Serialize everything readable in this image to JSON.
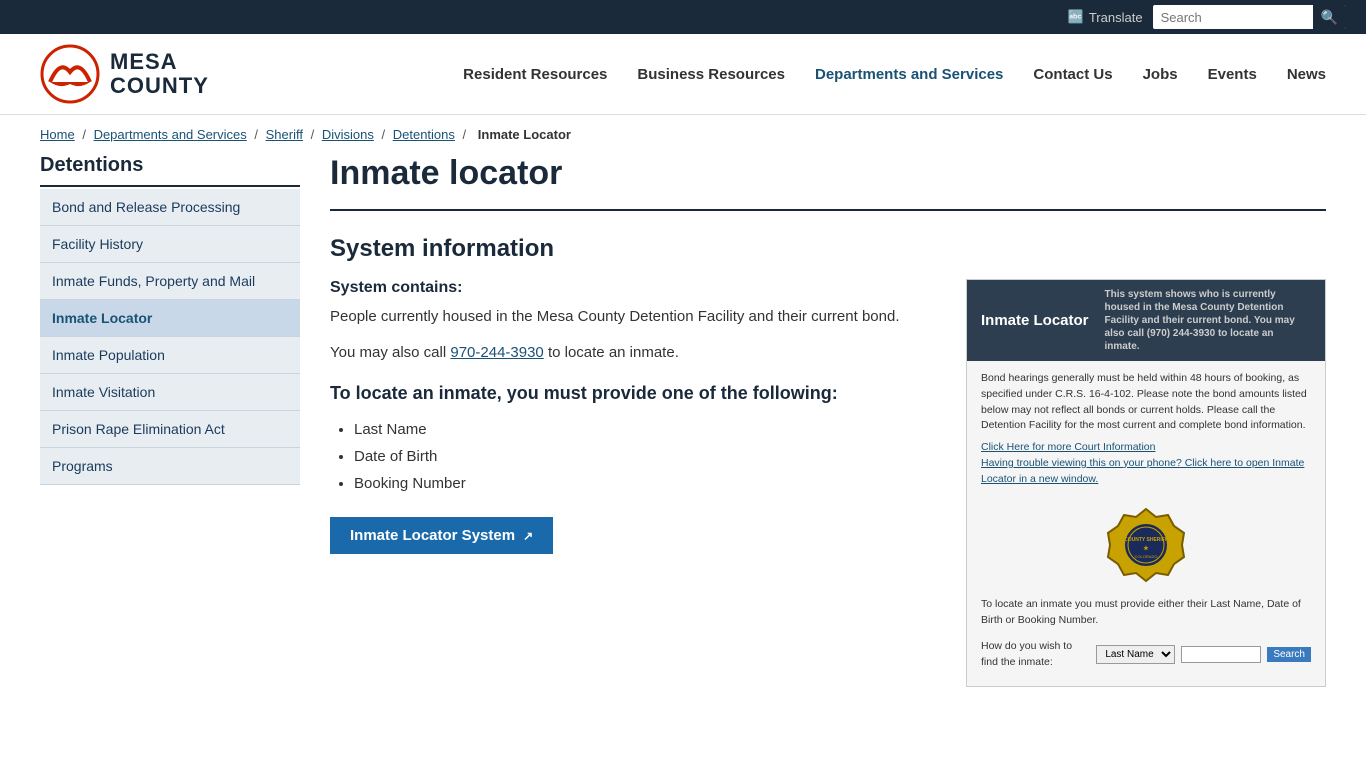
{
  "topbar": {
    "translate_label": "Translate",
    "search_placeholder": "Search"
  },
  "header": {
    "logo_text_line1": "MESA",
    "logo_text_line2": "COUNTY",
    "nav_items": [
      {
        "label": "Resident Resources",
        "id": "resident-resources"
      },
      {
        "label": "Business Resources",
        "id": "business-resources"
      },
      {
        "label": "Departments and Services",
        "id": "departments-services"
      },
      {
        "label": "Contact Us",
        "id": "contact-us"
      },
      {
        "label": "Jobs",
        "id": "jobs"
      },
      {
        "label": "Events",
        "id": "events"
      },
      {
        "label": "News",
        "id": "news"
      }
    ]
  },
  "breadcrumb": {
    "items": [
      {
        "label": "Home",
        "href": "#"
      },
      {
        "label": "Departments and Services",
        "href": "#"
      },
      {
        "label": "Sheriff",
        "href": "#"
      },
      {
        "label": "Divisions",
        "href": "#"
      },
      {
        "label": "Detentions",
        "href": "#"
      },
      {
        "label": "Inmate Locator",
        "current": true
      }
    ]
  },
  "sidebar": {
    "title": "Detentions",
    "items": [
      {
        "label": "Bond and Release Processing",
        "active": false
      },
      {
        "label": "Facility History",
        "active": false
      },
      {
        "label": "Inmate Funds, Property and Mail",
        "active": false
      },
      {
        "label": "Inmate Locator",
        "active": true
      },
      {
        "label": "Inmate Population",
        "active": false
      },
      {
        "label": "Inmate Visitation",
        "active": false
      },
      {
        "label": "Prison Rape Elimination Act",
        "active": false
      },
      {
        "label": "Programs",
        "active": false
      }
    ]
  },
  "main": {
    "page_title": "Inmate locator",
    "section_heading": "System information",
    "system_contains_label": "System contains:",
    "body_text_1": "People currently housed in the Mesa County Detention Facility and their current bond.",
    "body_text_2_prefix": "You may also call ",
    "phone": "970-244-3930",
    "body_text_2_suffix": " to locate an inmate.",
    "bold_heading": "To locate an inmate, you must provide one of the following:",
    "bullet_items": [
      "Last Name",
      "Date of Birth",
      "Booking Number"
    ],
    "cta_label": "Inmate Locator System"
  },
  "preview": {
    "header_title": "Inmate Locator",
    "header_desc": "This system shows who is currently housed in the Mesa County Detention Facility and their current bond. You may also call (970) 244-3930 to locate an inmate.",
    "bond_text": "Bond hearings generally must be held within 48 hours of booking, as specified under C.R.S. 16-4-102. Please note the bond amounts listed below may not reflect all bonds or current holds. Please call the Detention Facility for the most current and complete bond information.",
    "link1": "Click Here for more Court Information",
    "link2": "Having trouble viewing this on your phone? Click here to open Inmate Locator in a new window.",
    "search_label": "How do you wish to find the inmate:",
    "search_option": "Last Name",
    "search_button": "Search"
  }
}
